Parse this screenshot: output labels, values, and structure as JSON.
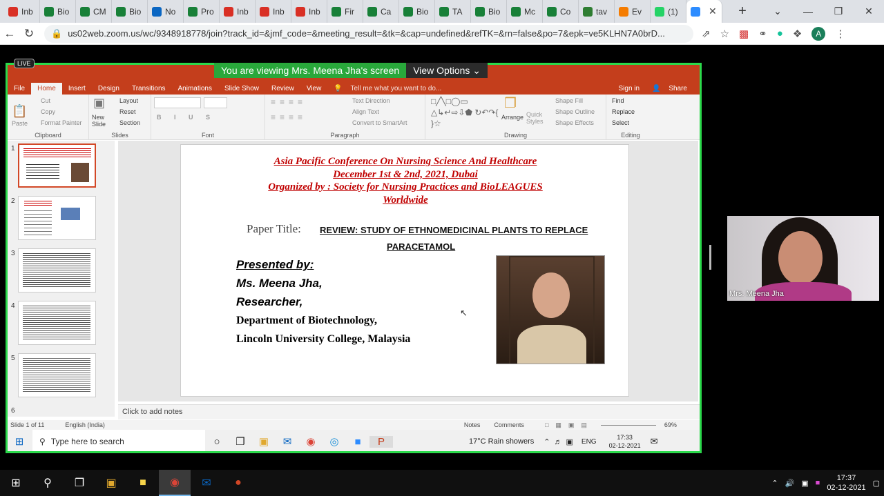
{
  "browser": {
    "tabs": [
      {
        "label": "Inb",
        "icon": "gmail-icon",
        "color": "#d93025"
      },
      {
        "label": "Bio",
        "icon": "sheets-icon",
        "color": "#188038"
      },
      {
        "label": "CM",
        "icon": "sheets-icon",
        "color": "#188038"
      },
      {
        "label": "Bio",
        "icon": "sheets-icon",
        "color": "#188038"
      },
      {
        "label": "No",
        "icon": "linkedin-icon",
        "color": "#0a66c2"
      },
      {
        "label": "Pro",
        "icon": "sheets-icon",
        "color": "#188038"
      },
      {
        "label": "Inb",
        "icon": "gmail-icon",
        "color": "#d93025"
      },
      {
        "label": "Inb",
        "icon": "gmail-icon",
        "color": "#d93025"
      },
      {
        "label": "Inb",
        "icon": "gmail-icon",
        "color": "#d93025"
      },
      {
        "label": "Fir",
        "icon": "sheets-icon",
        "color": "#188038"
      },
      {
        "label": "Ca",
        "icon": "sheets-icon",
        "color": "#188038"
      },
      {
        "label": "Bio",
        "icon": "sheets-icon",
        "color": "#188038"
      },
      {
        "label": "TA",
        "icon": "sheets-icon",
        "color": "#188038"
      },
      {
        "label": "Bio",
        "icon": "sheets-icon",
        "color": "#188038"
      },
      {
        "label": "Mc",
        "icon": "sheets-icon",
        "color": "#188038"
      },
      {
        "label": "Co",
        "icon": "sheets-icon",
        "color": "#188038"
      },
      {
        "label": "tav",
        "icon": "leaf-icon",
        "color": "#2e7d32"
      },
      {
        "label": "Ev",
        "icon": "ten-icon",
        "color": "#f57c00"
      },
      {
        "label": "(1)",
        "icon": "whatsapp-icon",
        "color": "#25d366"
      },
      {
        "label": "",
        "icon": "zoom-icon",
        "color": "#2d8cff",
        "active": true
      }
    ],
    "url": "us02web.zoom.us/wc/9348918778/join?track_id=&jmf_code=&meeting_result=&tk=&cap=undefined&refTK=&rn=false&po=7&epk=ve5KLHN7A0brD..."
  },
  "zoom": {
    "live_badge": "LIVE",
    "banner_message": "You are viewing Mrs. Meena Jha's screen",
    "view_options": "View Options ⌄",
    "participant_name": "Mrs. Meena Jha"
  },
  "ppt": {
    "tabs": [
      "File",
      "Home",
      "Insert",
      "Design",
      "Transitions",
      "Animations",
      "Slide Show",
      "Review",
      "View"
    ],
    "tell_me": "Tell me what you want to do...",
    "sign_in": "Sign in",
    "share": "Share",
    "ribbon": {
      "clipboard": {
        "label": "Clipboard",
        "paste": "Paste",
        "cut": "Cut",
        "copy": "Copy",
        "format_painter": "Format Painter"
      },
      "slides": {
        "label": "Slides",
        "new_slide": "New Slide",
        "layout": "Layout",
        "reset": "Reset",
        "section": "Section"
      },
      "font": {
        "label": "Font"
      },
      "paragraph": {
        "label": "Paragraph",
        "text_direction": "Text Direction",
        "align_text": "Align Text",
        "smartart": "Convert to SmartArt"
      },
      "drawing": {
        "label": "Drawing",
        "arrange": "Arrange",
        "quick_styles": "Quick Styles",
        "shape_fill": "Shape Fill",
        "shape_outline": "Shape Outline",
        "shape_effects": "Shape Effects"
      },
      "editing": {
        "label": "Editing",
        "find": "Find",
        "replace": "Replace",
        "select": "Select"
      }
    },
    "thumb_numbers": [
      "1",
      "2",
      "3",
      "4",
      "5",
      "6"
    ],
    "slide": {
      "conf_line1": "Asia Pacific Conference On Nursing Science And Healthcare",
      "conf_line2": "December 1st & 2nd, 2021, Dubai",
      "conf_line3": "Organized by : Society for Nursing Practices and BioLEAGUES",
      "conf_line4": "Worldwide",
      "paper_label": "Paper Title:",
      "paper_title1": "REVIEW:  STUDY OF ETHNOMEDICINAL PLANTS TO REPLACE",
      "paper_title2": "PARACETAMOL",
      "presented_by": "Presented by:",
      "presenter": "Ms. Meena Jha,",
      "role": "Researcher,",
      "department": "Department of Biotechnology,",
      "college": "Lincoln University College, Malaysia"
    },
    "notes_placeholder": "Click to add notes",
    "status": {
      "slide_of": "Slide 1 of 11",
      "language": "English (India)",
      "notes": "Notes",
      "comments": "Comments",
      "zoom": "69%"
    }
  },
  "inner_taskbar": {
    "search": "Type here to search",
    "weather": "17°C  Rain showers",
    "lang": "ENG",
    "time": "17:33",
    "date": "02-12-2021"
  },
  "outer_taskbar": {
    "time": "17:37",
    "date": "02-12-2021"
  }
}
